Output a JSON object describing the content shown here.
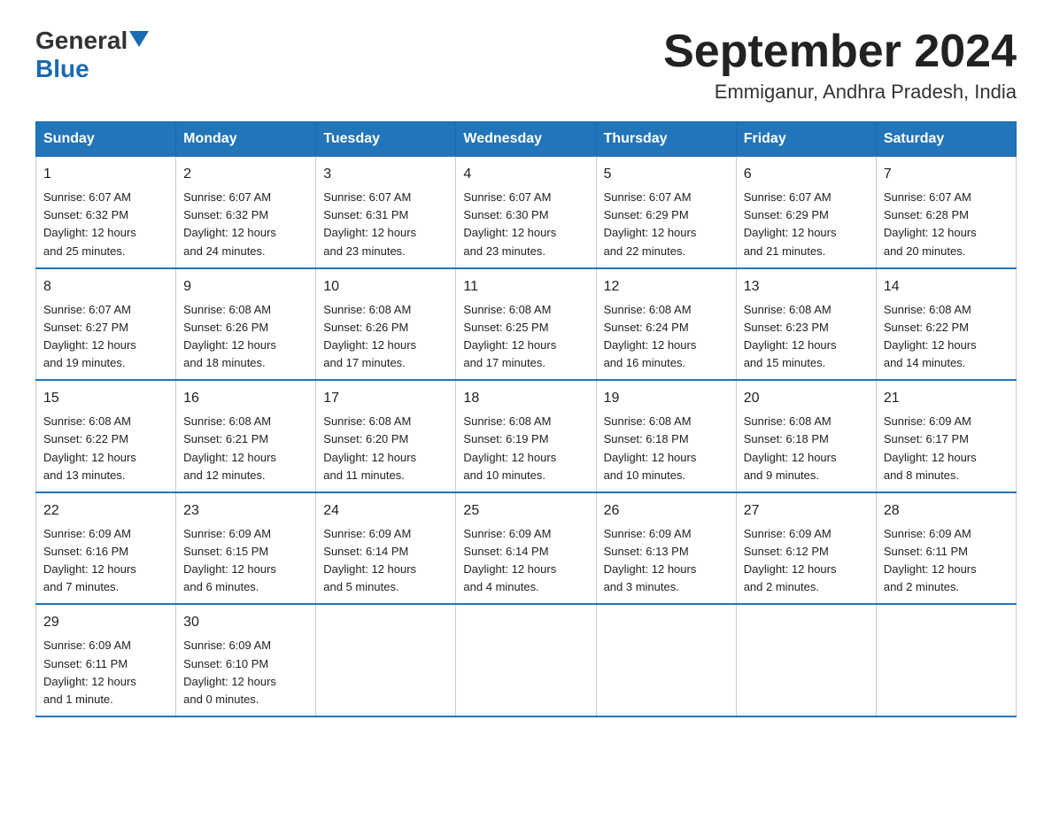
{
  "logo": {
    "general": "General",
    "blue": "Blue"
  },
  "title": "September 2024",
  "subtitle": "Emmiganur, Andhra Pradesh, India",
  "weekdays": [
    "Sunday",
    "Monday",
    "Tuesday",
    "Wednesday",
    "Thursday",
    "Friday",
    "Saturday"
  ],
  "weeks": [
    [
      {
        "day": "1",
        "sunrise": "6:07 AM",
        "sunset": "6:32 PM",
        "daylight": "12 hours and 25 minutes."
      },
      {
        "day": "2",
        "sunrise": "6:07 AM",
        "sunset": "6:32 PM",
        "daylight": "12 hours and 24 minutes."
      },
      {
        "day": "3",
        "sunrise": "6:07 AM",
        "sunset": "6:31 PM",
        "daylight": "12 hours and 23 minutes."
      },
      {
        "day": "4",
        "sunrise": "6:07 AM",
        "sunset": "6:30 PM",
        "daylight": "12 hours and 23 minutes."
      },
      {
        "day": "5",
        "sunrise": "6:07 AM",
        "sunset": "6:29 PM",
        "daylight": "12 hours and 22 minutes."
      },
      {
        "day": "6",
        "sunrise": "6:07 AM",
        "sunset": "6:29 PM",
        "daylight": "12 hours and 21 minutes."
      },
      {
        "day": "7",
        "sunrise": "6:07 AM",
        "sunset": "6:28 PM",
        "daylight": "12 hours and 20 minutes."
      }
    ],
    [
      {
        "day": "8",
        "sunrise": "6:07 AM",
        "sunset": "6:27 PM",
        "daylight": "12 hours and 19 minutes."
      },
      {
        "day": "9",
        "sunrise": "6:08 AM",
        "sunset": "6:26 PM",
        "daylight": "12 hours and 18 minutes."
      },
      {
        "day": "10",
        "sunrise": "6:08 AM",
        "sunset": "6:26 PM",
        "daylight": "12 hours and 17 minutes."
      },
      {
        "day": "11",
        "sunrise": "6:08 AM",
        "sunset": "6:25 PM",
        "daylight": "12 hours and 17 minutes."
      },
      {
        "day": "12",
        "sunrise": "6:08 AM",
        "sunset": "6:24 PM",
        "daylight": "12 hours and 16 minutes."
      },
      {
        "day": "13",
        "sunrise": "6:08 AM",
        "sunset": "6:23 PM",
        "daylight": "12 hours and 15 minutes."
      },
      {
        "day": "14",
        "sunrise": "6:08 AM",
        "sunset": "6:22 PM",
        "daylight": "12 hours and 14 minutes."
      }
    ],
    [
      {
        "day": "15",
        "sunrise": "6:08 AM",
        "sunset": "6:22 PM",
        "daylight": "12 hours and 13 minutes."
      },
      {
        "day": "16",
        "sunrise": "6:08 AM",
        "sunset": "6:21 PM",
        "daylight": "12 hours and 12 minutes."
      },
      {
        "day": "17",
        "sunrise": "6:08 AM",
        "sunset": "6:20 PM",
        "daylight": "12 hours and 11 minutes."
      },
      {
        "day": "18",
        "sunrise": "6:08 AM",
        "sunset": "6:19 PM",
        "daylight": "12 hours and 10 minutes."
      },
      {
        "day": "19",
        "sunrise": "6:08 AM",
        "sunset": "6:18 PM",
        "daylight": "12 hours and 10 minutes."
      },
      {
        "day": "20",
        "sunrise": "6:08 AM",
        "sunset": "6:18 PM",
        "daylight": "12 hours and 9 minutes."
      },
      {
        "day": "21",
        "sunrise": "6:09 AM",
        "sunset": "6:17 PM",
        "daylight": "12 hours and 8 minutes."
      }
    ],
    [
      {
        "day": "22",
        "sunrise": "6:09 AM",
        "sunset": "6:16 PM",
        "daylight": "12 hours and 7 minutes."
      },
      {
        "day": "23",
        "sunrise": "6:09 AM",
        "sunset": "6:15 PM",
        "daylight": "12 hours and 6 minutes."
      },
      {
        "day": "24",
        "sunrise": "6:09 AM",
        "sunset": "6:14 PM",
        "daylight": "12 hours and 5 minutes."
      },
      {
        "day": "25",
        "sunrise": "6:09 AM",
        "sunset": "6:14 PM",
        "daylight": "12 hours and 4 minutes."
      },
      {
        "day": "26",
        "sunrise": "6:09 AM",
        "sunset": "6:13 PM",
        "daylight": "12 hours and 3 minutes."
      },
      {
        "day": "27",
        "sunrise": "6:09 AM",
        "sunset": "6:12 PM",
        "daylight": "12 hours and 2 minutes."
      },
      {
        "day": "28",
        "sunrise": "6:09 AM",
        "sunset": "6:11 PM",
        "daylight": "12 hours and 2 minutes."
      }
    ],
    [
      {
        "day": "29",
        "sunrise": "6:09 AM",
        "sunset": "6:11 PM",
        "daylight": "12 hours and 1 minute."
      },
      {
        "day": "30",
        "sunrise": "6:09 AM",
        "sunset": "6:10 PM",
        "daylight": "12 hours and 0 minutes."
      },
      null,
      null,
      null,
      null,
      null
    ]
  ],
  "labels": {
    "sunrise": "Sunrise:",
    "sunset": "Sunset:",
    "daylight": "Daylight:"
  }
}
